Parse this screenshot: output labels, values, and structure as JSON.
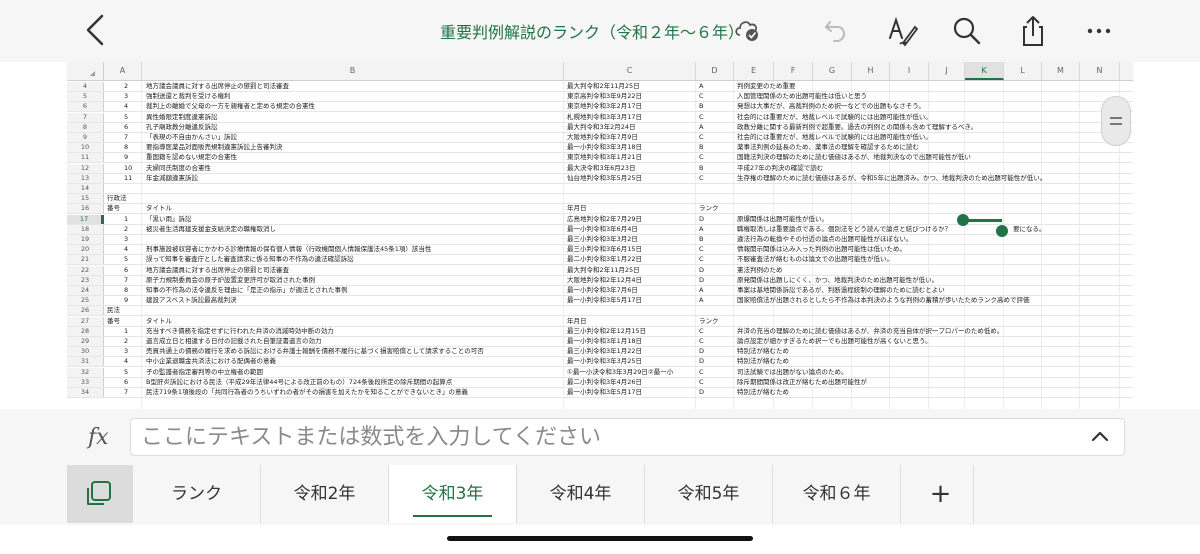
{
  "header": {
    "title": "重要判例解説のランク（令和２年〜６年）",
    "icons": [
      "back-icon",
      "cloud-saved-icon",
      "undo-icon",
      "pen-format-icon",
      "search-icon",
      "share-icon",
      "more-icon"
    ]
  },
  "grid": {
    "columns": [
      "A",
      "B",
      "C",
      "D",
      "E",
      "F",
      "G",
      "H",
      "I",
      "J",
      "K",
      "L",
      "M",
      "N"
    ],
    "selected_column": "K",
    "selected_row": "17",
    "rows": [
      {
        "n": "4",
        "A": "2",
        "B": "地方議会議員に対する出席停止の懲罰と司法審査",
        "C": "最大判令和2年11月25日",
        "D": "A",
        "E": "判例変更のため重要"
      },
      {
        "n": "5",
        "A": "3",
        "B": "強制送還と裁判を受ける権利",
        "C": "東京高判令和3年9月22日",
        "D": "C",
        "E": "入国管理関係のため出題可能性は低いと思う"
      },
      {
        "n": "6",
        "A": "4",
        "B": "裁判上の離婚で父母の一方を親権者と定める規定の合憲性",
        "C": "東京地判令和3年2月17日",
        "D": "B",
        "E": "発想は大事だが、高裁判例のため択一などでの出題もなさそう。"
      },
      {
        "n": "7",
        "A": "5",
        "B": "異性婚限定制度違憲訴訟",
        "C": "札幌地判令和3年3月17日",
        "D": "C",
        "E": "社会的には重要だが、地裁レベルで試験的には出題可能性が低い。"
      },
      {
        "n": "8",
        "A": "6",
        "B": "孔子廟政教分離違反訴訟",
        "C": "最大判令和3年2月24日",
        "D": "A",
        "E": "政教分離に関する最新判例で超重要。過去の判例との関係も含めて理解するべき。"
      },
      {
        "n": "9",
        "A": "7",
        "B": "「表現の不自由かんさい」訴訟",
        "C": "大阪地判令和3年7月9日",
        "D": "C",
        "E": "社会的には重要だが、地裁レベルで試験的には出題可能性が低い。"
      },
      {
        "n": "10",
        "A": "8",
        "B": "要指導医薬品対面販売規制違憲訴訟上告審判決",
        "C": "最一小判令和3年3月18日",
        "D": "B",
        "E": "薬事法判例の延長のため、薬事法の理解を確認するために読む"
      },
      {
        "n": "11",
        "A": "9",
        "B": "重国籍を認めない規定の合憲性",
        "C": "東京地判令和3年1月21日",
        "D": "C",
        "E": "国籍法判決の理解のために読む価値はあるが、地裁判決なので出題可能性が低い"
      },
      {
        "n": "12",
        "A": "10",
        "B": "夫婦同氏制度の合憲性",
        "C": "最大決令和3年6月23日",
        "D": "B",
        "E": "平成27年の判決の確認で読む"
      },
      {
        "n": "13",
        "A": "11",
        "B": "年金減額違憲訴訟",
        "C": "仙台地判令和3年5月25日",
        "D": "C",
        "E": "生存権の理解のために読む価値はあるが、令和5年に出題済み。かつ、地裁判決のため出題可能性が低い。"
      },
      {
        "n": "14"
      },
      {
        "n": "15",
        "A": "行政法"
      },
      {
        "n": "16",
        "A": "番号",
        "B": "タイトル",
        "C": "年月日",
        "D": "ランク"
      },
      {
        "n": "17",
        "A": "1",
        "B": "「黒い雨」訴訟",
        "C": "広島地判令和2年7月29日",
        "D": "D",
        "E": "原爆関係は出題可能性が低い。"
      },
      {
        "n": "18",
        "A": "2",
        "B": "被災者生活再建支援金支給決定の職権取消し",
        "C": "最一小判令和3年6月4日",
        "D": "A",
        "E": "職権取消しは重要論点である。個別法をどう読んで論点と結びつけるか？",
        "E2": "要になる。"
      },
      {
        "n": "19",
        "A": "3",
        "B": "",
        "C": "最三小判令和3年3月2日",
        "D": "B",
        "E": "違法行為の転換やその付近の論点の出題可能性がほぼない。"
      },
      {
        "n": "20",
        "A": "4",
        "B": "刑事施設被収容者にかかわる診療情報の保有個人情報（行政機関個人情報保護法45条1項）該当性",
        "C": "最三小判令和3年6月15日",
        "D": "C",
        "E": "情報開示関係は込み入った判例の出題可能性は低いため。"
      },
      {
        "n": "21",
        "A": "5",
        "B": "誤って知事を審査庁とした審査請求に係る知事の不作為の違法確認訴訟",
        "C": "最二小判令和3年1月22日",
        "D": "C",
        "E": "不服審査法が絡むものは論文での出題可能性が低い。"
      },
      {
        "n": "22",
        "A": "6",
        "B": "地方議会議員に対する出席停止の懲罰と司法審査",
        "C": "最大判令和2年11月25日",
        "D": "D",
        "E": "憲法判例のため"
      },
      {
        "n": "23",
        "A": "7",
        "B": "原子力規制委員会の原子炉設置変更許可が取消された事例",
        "C": "大阪地判令和2年12月4日",
        "D": "D",
        "E": "原発関係は出題しにくく、かつ、地裁判決のため出題可能性が低い。"
      },
      {
        "n": "24",
        "A": "8",
        "B": "知事の不作為の法令違反を理由に「是正の指示」が適法とされた事例",
        "C": "最一小判令和3年7月6日",
        "D": "A",
        "E": "事案は基地関係訴訟であるが、判断過程統制の理解のために読むとよい"
      },
      {
        "n": "25",
        "A": "9",
        "B": "建設アスベスト訴訟最高裁判決",
        "C": "最一小判令和3年5月17日",
        "D": "A",
        "E": "国家賠償法が出題されるとしたら不作為は本判決のような判例の蓄積が歩いたためランク高めで評価"
      },
      {
        "n": "26",
        "A": "民法"
      },
      {
        "n": "27",
        "A": "番号",
        "B": "タイトル",
        "C": "年月日",
        "D": "ランク"
      },
      {
        "n": "28",
        "A": "1",
        "B": "充当すべき債務を指定せずに行われた弁済の消滅時効中断の効力",
        "C": "最三小判令和2年12月15日",
        "D": "C",
        "E": "弁済の充当の理解のために読む価値はあるが、弁済の充当自体が択一プロパーのため低め。"
      },
      {
        "n": "29",
        "A": "2",
        "B": "遺言成立日と相違する日付の記載された自筆証書遺言の効力",
        "C": "最一小判令和3年1月18日",
        "D": "C",
        "E": "論点設定が細かすぎるため択一でも出題可能性が高くないと思う。"
      },
      {
        "n": "30",
        "A": "3",
        "B": "売買共通上の債務の履行を求める訴訟における弁護士報酬を債務不履行に基づく損害賠償として請求することの可否",
        "C": "最三小判令和3年1月22日",
        "D": "D",
        "E": "特別法が絡むため"
      },
      {
        "n": "31",
        "A": "4",
        "B": "中小企業退職金共済法における配偶者の意義",
        "C": "最一小判令和3年3月25日",
        "D": "D",
        "E": "特別法が絡むため"
      },
      {
        "n": "32",
        "A": "5",
        "B": "子の監護者指定審判等の中立権者の範囲",
        "C": "①最一小決令和3年3月29日②最一小",
        "D": "C",
        "E": "司法試験では出題がない論点のため。"
      },
      {
        "n": "33",
        "A": "6",
        "B": "B型肝炎訴訟における民法（平成29年法律44号による改正前のもの）724条後段所定の除斥期間の起算点",
        "C": "最二小判令和3年4月26日",
        "D": "C",
        "E": "除斥期間関係は改正が絡むため出題可能性が"
      },
      {
        "n": "34",
        "A": "7",
        "B": "民法719条1項後段の「共同行為者のうちいずれの者がその損害を加えたかを知ることができないとき」の意義",
        "C": "最一小判令和3年5月17日",
        "D": "D",
        "E": "特別法が絡むため"
      }
    ]
  },
  "formula_bar": {
    "fx_label": "fx",
    "placeholder": "ここにテキストまたは数式を入力してください"
  },
  "tabs": {
    "items": [
      "ランク",
      "令和2年",
      "令和3年",
      "令和4年",
      "令和5年",
      "令和６年"
    ],
    "active": 2,
    "add_label": "+"
  },
  "colors": {
    "accent": "#217346"
  }
}
